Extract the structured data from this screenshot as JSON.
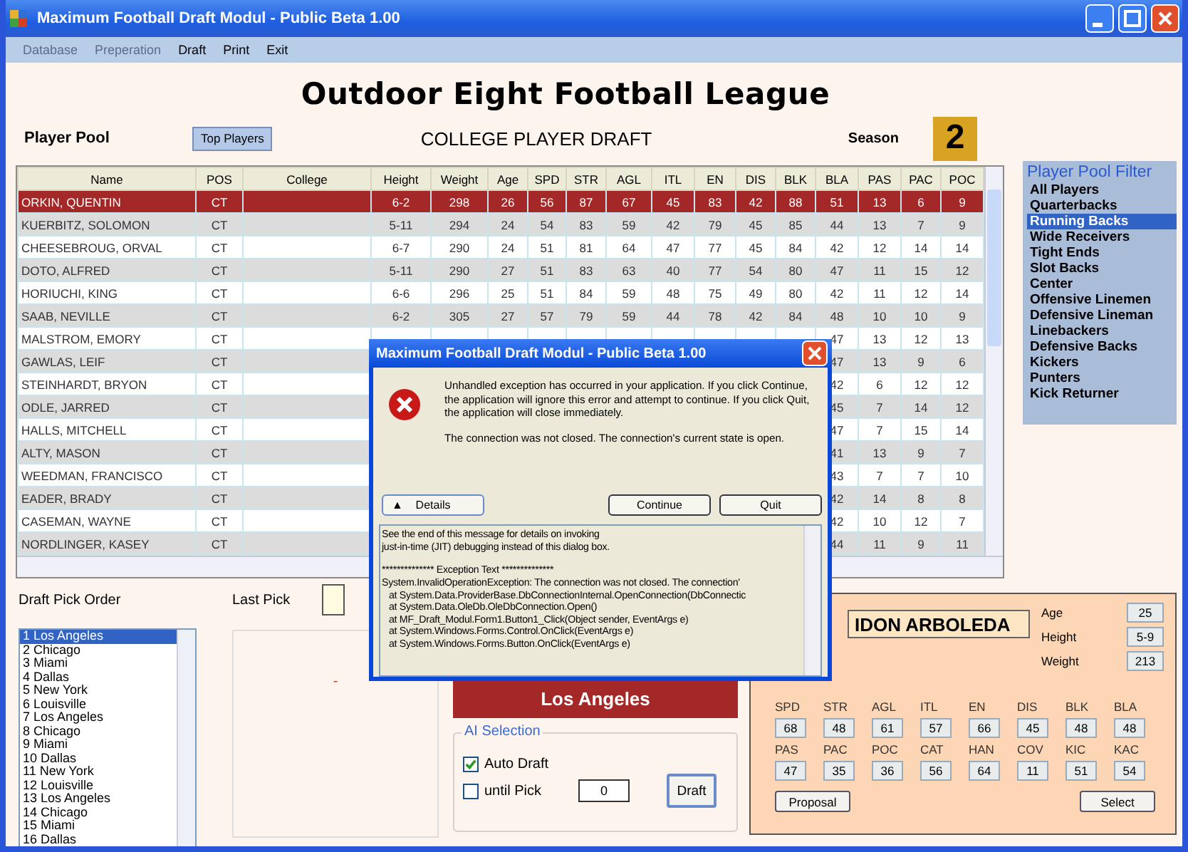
{
  "window": {
    "title": "Maximum Football Draft Modul - Public Beta 1.00"
  },
  "menu": [
    {
      "label": "Database",
      "disabled": true
    },
    {
      "label": "Preperation",
      "disabled": true
    },
    {
      "label": "Draft",
      "disabled": false
    },
    {
      "label": "Print",
      "disabled": false
    },
    {
      "label": "Exit",
      "disabled": false
    }
  ],
  "league_title": "Outdoor Eight Football League",
  "header": {
    "pool_label": "Player Pool",
    "top_players_button": "Top Players",
    "draft_title": "COLLEGE PLAYER DRAFT",
    "season_label": "Season",
    "season_value": "2"
  },
  "table": {
    "columns": [
      "Name",
      "POS",
      "College",
      "Height",
      "Weight",
      "Age",
      "SPD",
      "STR",
      "AGL",
      "ITL",
      "EN",
      "DIS",
      "BLK",
      "BLA",
      "PAS",
      "PAC",
      "POC"
    ],
    "rows": [
      {
        "selected": true,
        "cells": [
          "ORKIN, QUENTIN",
          "CT",
          null,
          "6-2",
          "298",
          "26",
          "56",
          "87",
          "67",
          "45",
          "83",
          "42",
          "88",
          "51",
          "13",
          "6",
          "9"
        ]
      },
      {
        "selected": false,
        "cells": [
          "KUERBITZ, SOLOMON",
          "CT",
          null,
          "5-11",
          "294",
          "24",
          "54",
          "83",
          "59",
          "42",
          "79",
          "45",
          "85",
          "44",
          "13",
          "7",
          "9"
        ]
      },
      {
        "selected": false,
        "cells": [
          "CHEESEBROUG, ORVAL",
          "CT",
          null,
          "6-7",
          "290",
          "24",
          "51",
          "81",
          "64",
          "47",
          "77",
          "45",
          "84",
          "42",
          "12",
          "14",
          "14"
        ]
      },
      {
        "selected": false,
        "cells": [
          "DOTO, ALFRED",
          "CT",
          null,
          "5-11",
          "290",
          "27",
          "51",
          "83",
          "63",
          "40",
          "77",
          "54",
          "80",
          "47",
          "11",
          "15",
          "12"
        ]
      },
      {
        "selected": false,
        "cells": [
          "HORIUCHI, KING",
          "CT",
          null,
          "6-6",
          "296",
          "25",
          "51",
          "84",
          "59",
          "48",
          "75",
          "49",
          "80",
          "42",
          "11",
          "12",
          "14"
        ]
      },
      {
        "selected": false,
        "cells": [
          "SAAB, NEVILLE",
          "CT",
          null,
          "6-2",
          "305",
          "27",
          "57",
          "79",
          "59",
          "44",
          "78",
          "42",
          "84",
          "48",
          "10",
          "10",
          "9"
        ]
      },
      {
        "selected": false,
        "cells": [
          "MALSTROM, EMORY",
          "CT",
          null,
          null,
          null,
          null,
          null,
          null,
          null,
          null,
          null,
          null,
          null,
          "47",
          "13",
          "12",
          "13"
        ]
      },
      {
        "selected": false,
        "cells": [
          "GAWLAS, LEIF",
          "CT",
          null,
          null,
          null,
          null,
          null,
          null,
          null,
          null,
          null,
          null,
          null,
          "47",
          "13",
          "9",
          "6"
        ]
      },
      {
        "selected": false,
        "cells": [
          "STEINHARDT, BRYON",
          "CT",
          null,
          null,
          null,
          null,
          null,
          null,
          null,
          null,
          null,
          null,
          null,
          "42",
          "6",
          "12",
          "12"
        ]
      },
      {
        "selected": false,
        "cells": [
          "ODLE, JARRED",
          "CT",
          null,
          null,
          null,
          null,
          null,
          null,
          null,
          null,
          null,
          null,
          null,
          "45",
          "7",
          "14",
          "12"
        ]
      },
      {
        "selected": false,
        "cells": [
          "HALLS, MITCHELL",
          "CT",
          null,
          null,
          null,
          null,
          null,
          null,
          null,
          null,
          null,
          null,
          null,
          "47",
          "7",
          "15",
          "14"
        ]
      },
      {
        "selected": false,
        "cells": [
          "ALTY, MASON",
          "CT",
          null,
          null,
          null,
          null,
          null,
          null,
          null,
          null,
          null,
          null,
          null,
          "41",
          "13",
          "9",
          "7"
        ]
      },
      {
        "selected": false,
        "cells": [
          "WEEDMAN, FRANCISCO",
          "CT",
          null,
          null,
          null,
          null,
          null,
          null,
          null,
          null,
          null,
          null,
          null,
          "43",
          "7",
          "7",
          "10"
        ]
      },
      {
        "selected": false,
        "cells": [
          "EADER, BRADY",
          "CT",
          null,
          null,
          null,
          null,
          null,
          null,
          null,
          null,
          null,
          null,
          null,
          "42",
          "14",
          "8",
          "8"
        ]
      },
      {
        "selected": false,
        "cells": [
          "CASEMAN, WAYNE",
          "CT",
          null,
          null,
          null,
          null,
          null,
          null,
          null,
          null,
          null,
          null,
          null,
          "42",
          "10",
          "12",
          "7"
        ]
      },
      {
        "selected": false,
        "cells": [
          "NORDLINGER, KASEY",
          "CT",
          null,
          null,
          null,
          null,
          null,
          null,
          null,
          null,
          null,
          null,
          null,
          "44",
          "11",
          "9",
          "11"
        ]
      }
    ]
  },
  "filter": {
    "title": "Player Pool Filter",
    "items": [
      {
        "label": "All Players",
        "selected": false
      },
      {
        "label": "Quarterbacks",
        "selected": false
      },
      {
        "label": "Running Backs",
        "selected": true
      },
      {
        "label": "Wide Receivers",
        "selected": false
      },
      {
        "label": "Tight Ends",
        "selected": false
      },
      {
        "label": "Slot Backs",
        "selected": false
      },
      {
        "label": "Center",
        "selected": false
      },
      {
        "label": "Offensive Linemen",
        "selected": false
      },
      {
        "label": "Defensive Lineman",
        "selected": false
      },
      {
        "label": "Linebackers",
        "selected": false
      },
      {
        "label": "Defensive Backs",
        "selected": false
      },
      {
        "label": "Kickers",
        "selected": false
      },
      {
        "label": "Punters",
        "selected": false
      },
      {
        "label": "Kick Returner",
        "selected": false
      }
    ]
  },
  "pick_order": {
    "label": "Draft Pick Order",
    "items": [
      {
        "label": "1 Los Angeles",
        "selected": true
      },
      {
        "label": "2 Chicago",
        "selected": false
      },
      {
        "label": "3 Miami",
        "selected": false
      },
      {
        "label": "4 Dallas",
        "selected": false
      },
      {
        "label": "5 New York",
        "selected": false
      },
      {
        "label": "6 Louisville",
        "selected": false
      },
      {
        "label": "7 Los Angeles",
        "selected": false
      },
      {
        "label": "8 Chicago",
        "selected": false
      },
      {
        "label": "9 Miami",
        "selected": false
      },
      {
        "label": "10 Dallas",
        "selected": false
      },
      {
        "label": "11 New York",
        "selected": false
      },
      {
        "label": "12 Louisville",
        "selected": false
      },
      {
        "label": "13 Los Angeles",
        "selected": false
      },
      {
        "label": "14 Chicago",
        "selected": false
      },
      {
        "label": "15 Miami",
        "selected": false
      },
      {
        "label": "16 Dallas",
        "selected": false
      }
    ]
  },
  "last_pick": {
    "label": "Last Pick",
    "panel_text": "-"
  },
  "current_team": "Los Angeles",
  "ai_selection": {
    "title": "AI Selection",
    "auto_draft": {
      "label": "Auto Draft",
      "checked": true
    },
    "until_pick": {
      "label": "until Pick",
      "checked": false
    },
    "pick_value": "0",
    "draft_button": "Draft"
  },
  "player_card": {
    "name": "IDON ARBOLEDA",
    "info": [
      {
        "label": "Age",
        "value": "25"
      },
      {
        "label": "Height",
        "value": "5-9"
      },
      {
        "label": "Weight",
        "value": "213"
      }
    ],
    "stats": [
      {
        "label": "SPD",
        "value": "68"
      },
      {
        "label": "STR",
        "value": "48"
      },
      {
        "label": "AGL",
        "value": "61"
      },
      {
        "label": "ITL",
        "value": "57"
      },
      {
        "label": "EN",
        "value": "66"
      },
      {
        "label": "DIS",
        "value": "45"
      },
      {
        "label": "BLK",
        "value": "48"
      },
      {
        "label": "BLA",
        "value": "48"
      },
      {
        "label": "PAS",
        "value": "47"
      },
      {
        "label": "PAC",
        "value": "35"
      },
      {
        "label": "POC",
        "value": "36"
      },
      {
        "label": "CAT",
        "value": "56"
      },
      {
        "label": "HAN",
        "value": "64"
      },
      {
        "label": "COV",
        "value": "11"
      },
      {
        "label": "KIC",
        "value": "51"
      },
      {
        "label": "KAC",
        "value": "54"
      }
    ],
    "proposal_button": "Proposal",
    "select_button": "Select"
  },
  "dialog": {
    "title": "Maximum Football Draft Modul - Public Beta 1.00",
    "message": "Unhandled exception has occurred in your application. If you click Continue, the application will ignore this error and attempt to continue. If you click Quit, the application will close immediately.",
    "detail_message": "The connection was not closed. The connection's current state is open.",
    "details_button": {
      "icon": "▲",
      "label": "Details"
    },
    "continue_button": "Continue",
    "quit_button": "Quit",
    "details_paragraphs": [
      [
        {
          "text": "See the end of this message for details on invoking",
          "indent": false
        },
        {
          "text": "just-in-time (JIT) debugging instead of this dialog box.",
          "indent": false
        }
      ],
      [
        {
          "text": "************** Exception Text **************",
          "indent": false
        },
        {
          "text": "System.InvalidOperationException: The connection was not closed. The connection'",
          "indent": false
        },
        {
          "text": "at System.Data.ProviderBase.DbConnectionInternal.OpenConnection(DbConnectic",
          "indent": true
        },
        {
          "text": "at System.Data.OleDb.OleDbConnection.Open()",
          "indent": true
        },
        {
          "text": "at MF_Draft_Modul.Form1.Button1_Click(Object sender, EventArgs e)",
          "indent": true
        },
        {
          "text": "at System.Windows.Forms.Control.OnClick(EventArgs e)",
          "indent": true
        },
        {
          "text": "at System.Windows.Forms.Button.OnClick(EventArgs e)",
          "indent": true
        }
      ]
    ]
  }
}
